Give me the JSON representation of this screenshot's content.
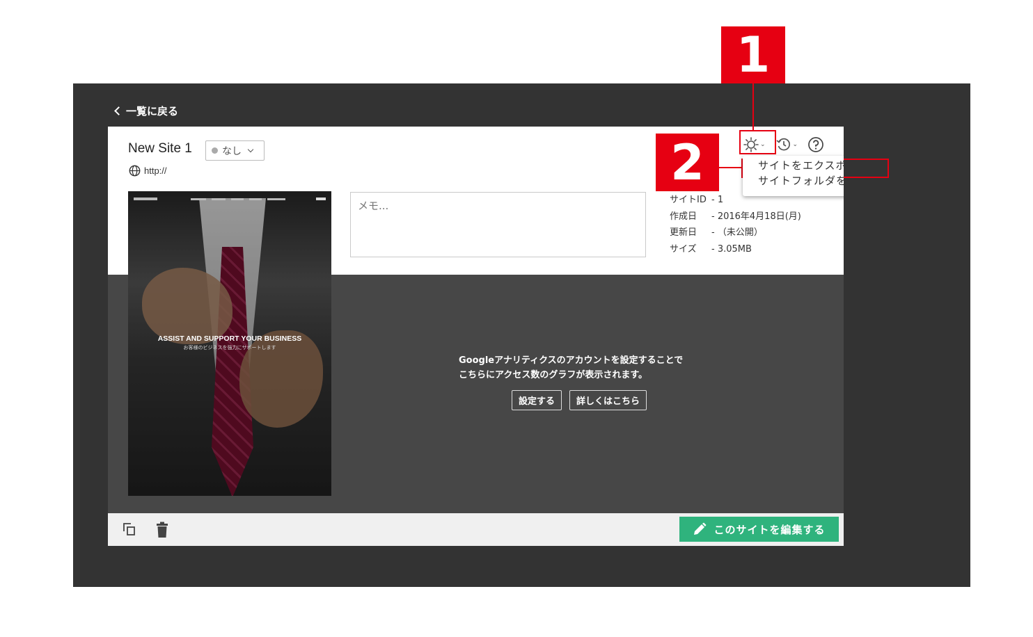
{
  "nav": {
    "back_label": "一覧に戻る"
  },
  "site": {
    "title": "New Site 1",
    "status_label": "なし",
    "url": "http://"
  },
  "menu": {
    "items": [
      {
        "label": "サイトをエクスポート",
        "highlighted": true
      },
      {
        "label": "サイトフォルダを開く",
        "highlighted": false
      }
    ]
  },
  "thumbnail": {
    "headline": "ASSIST AND SUPPORT YOUR BUSINESS",
    "subtext": "お客様のビジネスを強力にサポートします"
  },
  "memo": {
    "placeholder": "メモ..."
  },
  "info": [
    {
      "key": "サイトID",
      "value": "- 1"
    },
    {
      "key": "作成日",
      "value": "- 2016年4月18日(月)"
    },
    {
      "key": "更新日",
      "value": "- （未公開）"
    },
    {
      "key": "サイズ",
      "value": "- 3.05MB"
    }
  ],
  "analytics": {
    "line1": "Googleアナリティクスのアカウントを設定することで",
    "line2": "こちらにアクセス数のグラフが表示されます。",
    "setup_button": "設定する",
    "details_button": "詳しくはこちら"
  },
  "footer": {
    "edit_button": "このサイトを編集する"
  },
  "callouts": {
    "one": "1",
    "two": "2"
  },
  "colors": {
    "app_background": "#333333",
    "panel_background": "#ffffff",
    "analytics_band": "#474747",
    "footer_background": "#f0f0f0",
    "edit_button": "#2fb37d",
    "callout_red": "#e60012",
    "status_dot": "#aaaaaa"
  },
  "icons": [
    "chevron-left-icon",
    "globe-icon",
    "gear-icon",
    "history-icon",
    "help-icon",
    "duplicate-icon",
    "trash-icon",
    "pencil-icon"
  ]
}
